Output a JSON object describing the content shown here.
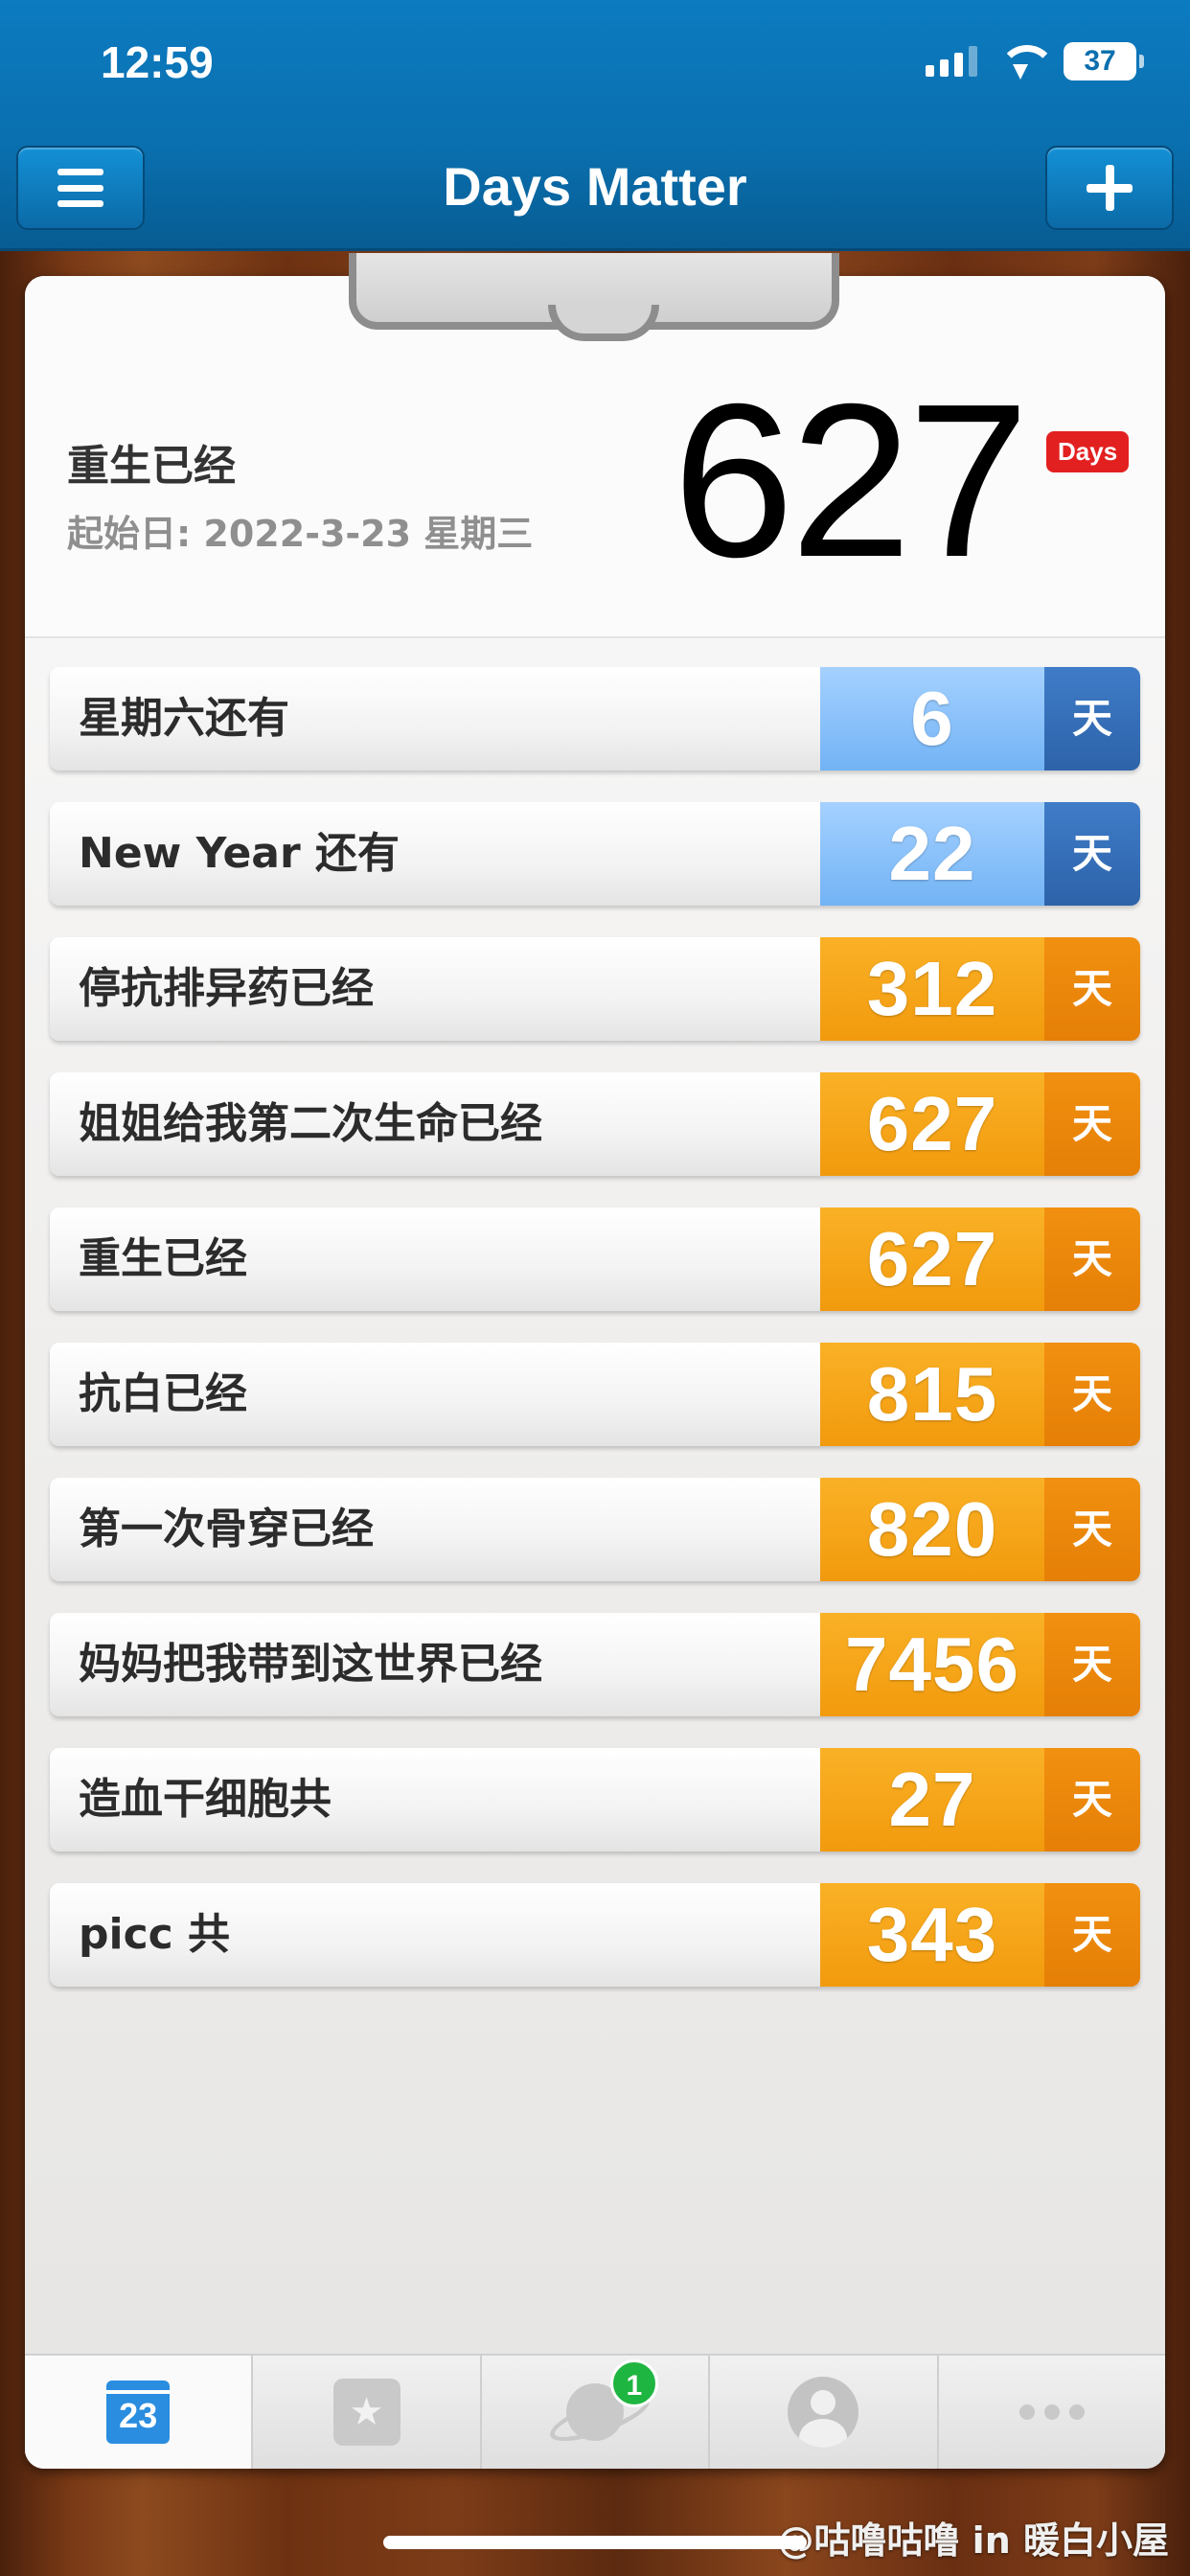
{
  "status_bar": {
    "time": "12:59",
    "battery": "37"
  },
  "header": {
    "title": "Days Matter",
    "menu_icon": "hamburger-menu-icon",
    "add_icon": "plus-icon"
  },
  "hero": {
    "label": "重生已经",
    "start_date": "起始日: 2022-3-23 星期三",
    "value": "627",
    "badge": "Days"
  },
  "events": [
    {
      "label": "星期六还有",
      "value": "6",
      "unit": "天",
      "type": "future"
    },
    {
      "label": "New Year 还有",
      "value": "22",
      "unit": "天",
      "type": "future"
    },
    {
      "label": "停抗排异药已经",
      "value": "312",
      "unit": "天",
      "type": "past"
    },
    {
      "label": "姐姐给我第二次生命已经",
      "value": "627",
      "unit": "天",
      "type": "past"
    },
    {
      "label": "重生已经",
      "value": "627",
      "unit": "天",
      "type": "past"
    },
    {
      "label": "抗白已经",
      "value": "815",
      "unit": "天",
      "type": "past"
    },
    {
      "label": "第一次骨穿已经",
      "value": "820",
      "unit": "天",
      "type": "past"
    },
    {
      "label": "妈妈把我带到这世界已经",
      "value": "7456",
      "unit": "天",
      "type": "past"
    },
    {
      "label": "造血干细胞共",
      "value": "27",
      "unit": "天",
      "type": "past"
    },
    {
      "label": "picc 共",
      "value": "343",
      "unit": "天",
      "type": "past"
    }
  ],
  "tabbar": {
    "calendar_day": "23",
    "discover_badge": "1",
    "icons": [
      "calendar-icon",
      "favorites-icon",
      "planet-icon",
      "user-icon",
      "more-icon"
    ]
  },
  "watermark": "@咕噜咕噜 in 暖白小屋",
  "colors": {
    "header": "#0a6fae",
    "future": "#72b3f5",
    "past": "#f29a0d",
    "badge": "#e32020"
  }
}
